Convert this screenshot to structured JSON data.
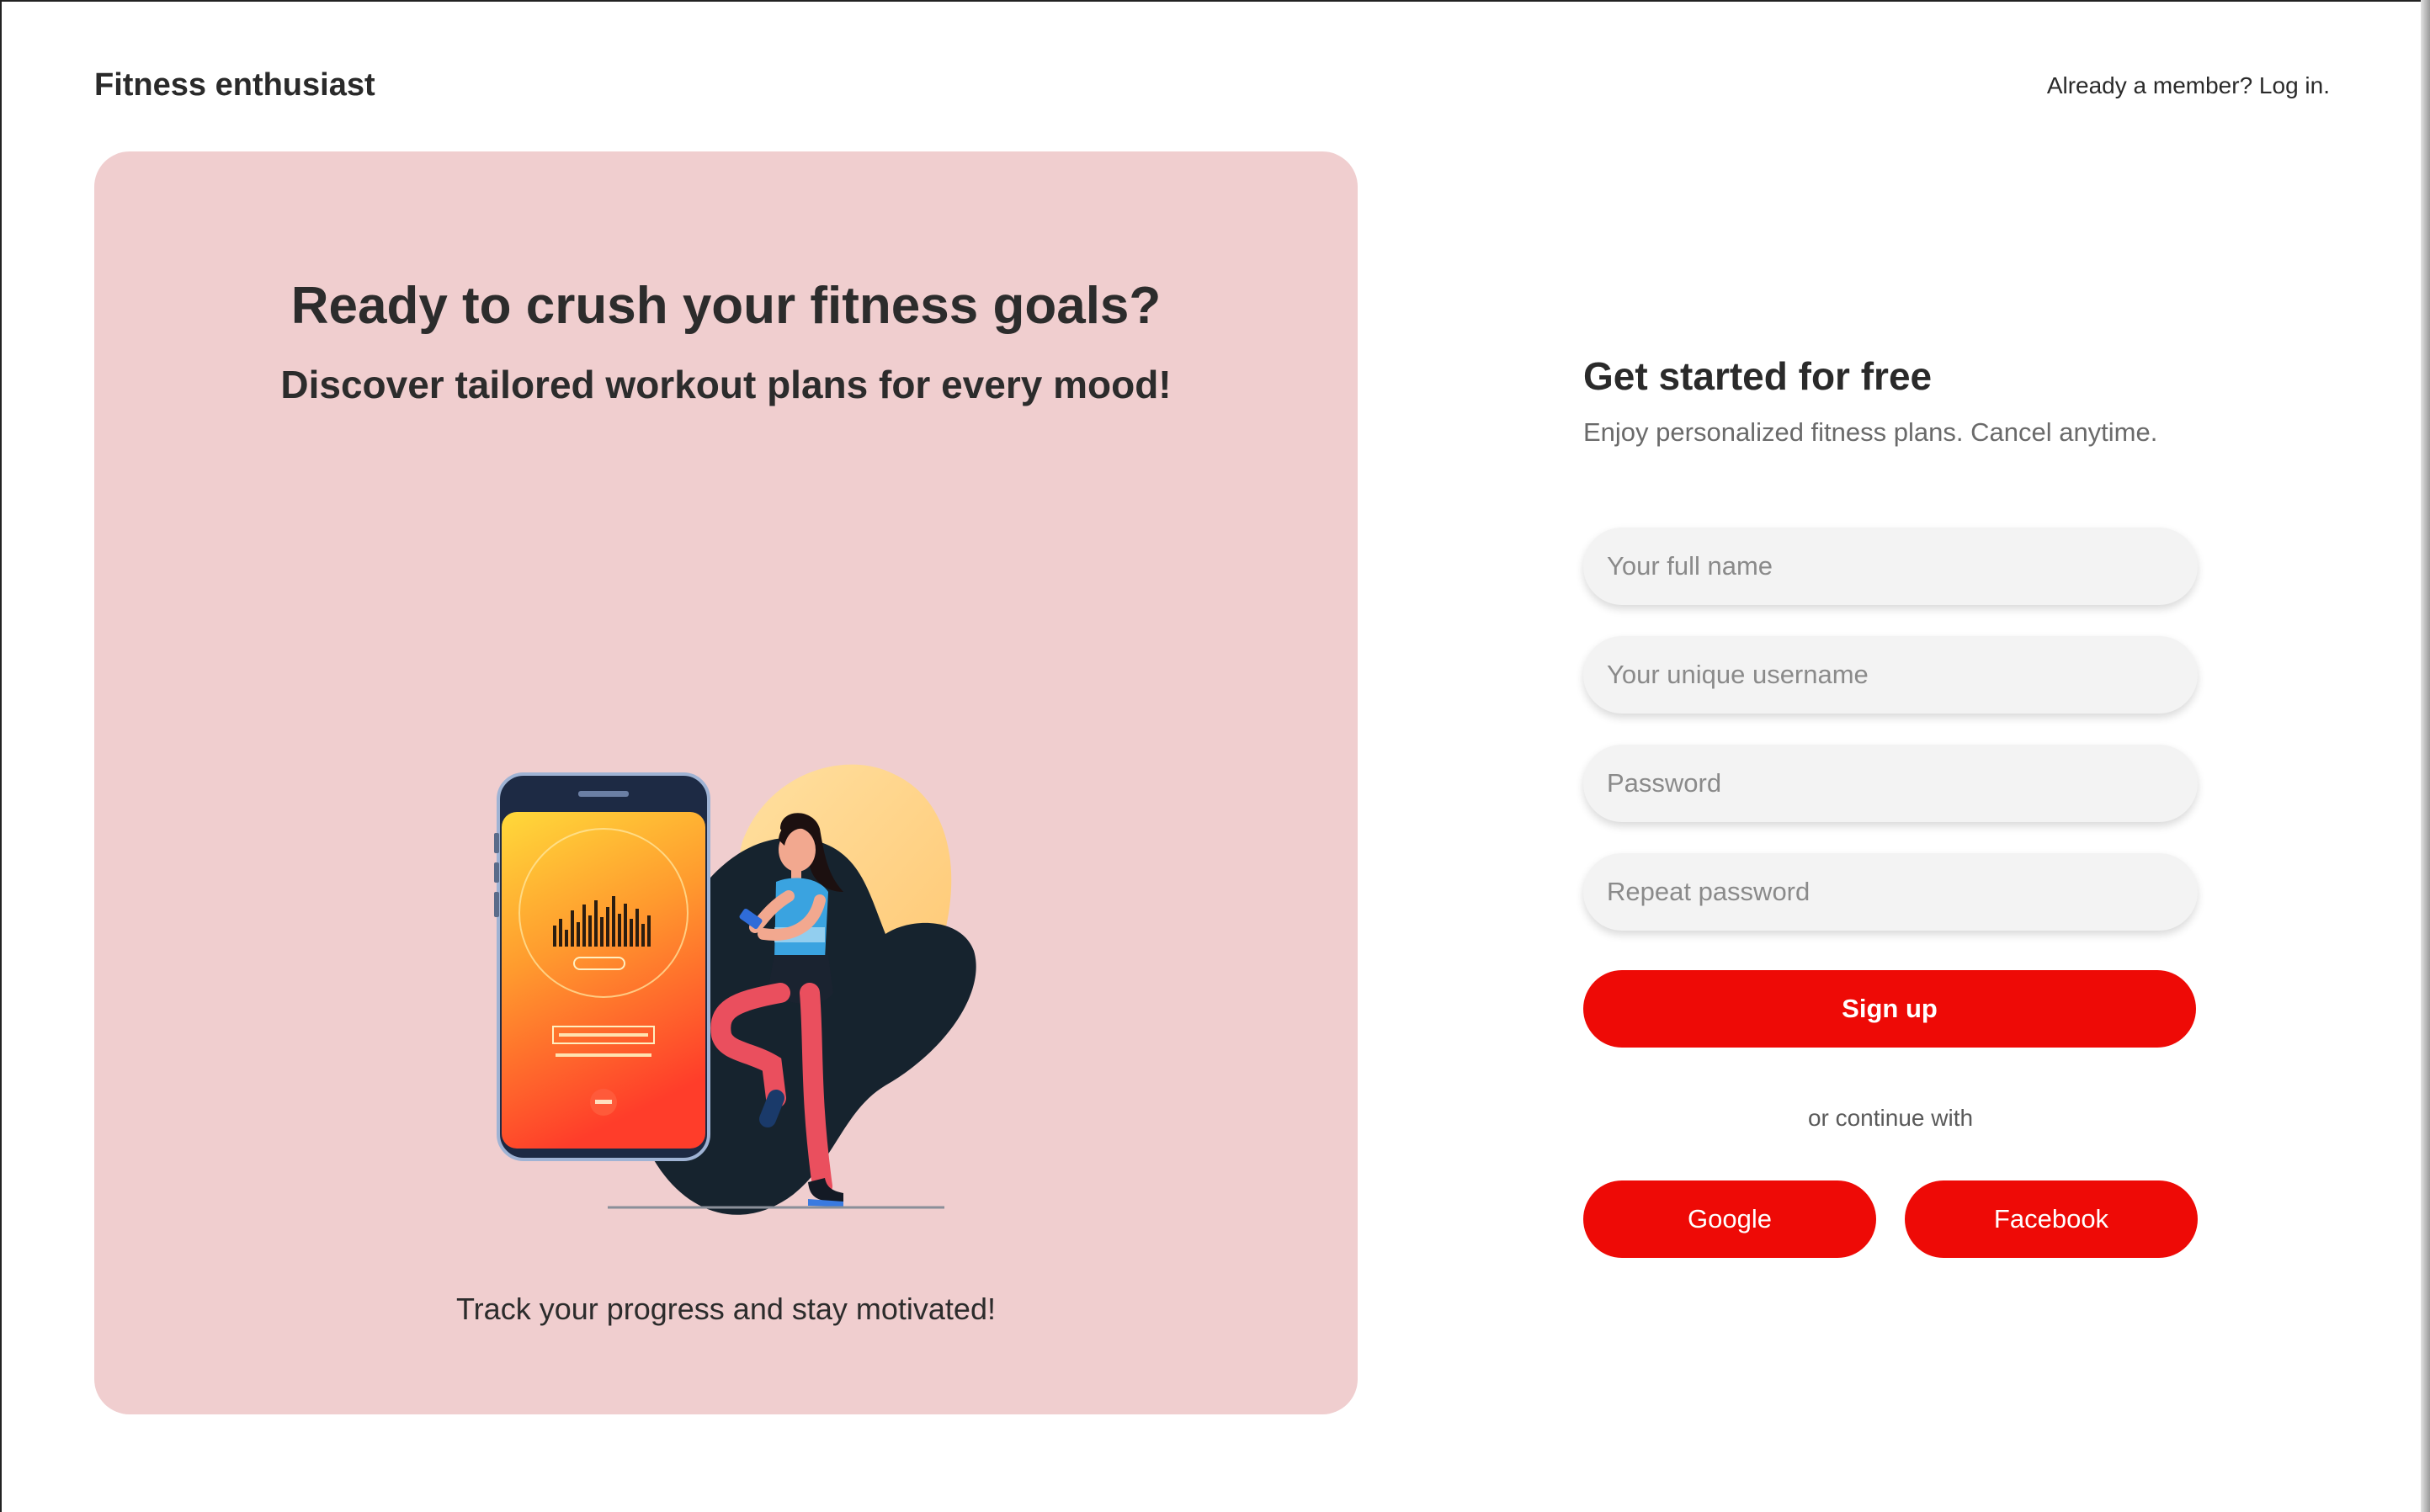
{
  "header": {
    "brand": "Fitness enthusiast",
    "login_link": "Already a member? Log in."
  },
  "hero": {
    "title": "Ready to crush your fitness goals?",
    "subtitle": "Discover tailored workout plans for every mood!",
    "caption": "Track your progress and stay motivated!",
    "background_color": "#f0cecf"
  },
  "form": {
    "title": "Get started for free",
    "subtitle": "Enjoy personalized fitness plans. Cancel anytime.",
    "fields": {
      "full_name": {
        "placeholder": "Your full name",
        "value": ""
      },
      "username": {
        "placeholder": "Your unique username",
        "value": ""
      },
      "password": {
        "placeholder": "Password",
        "value": ""
      },
      "repeat_password": {
        "placeholder": "Repeat password",
        "value": ""
      }
    },
    "signup_label": "Sign up",
    "divider_text": "or continue with",
    "social": {
      "google_label": "Google",
      "facebook_label": "Facebook"
    }
  },
  "colors": {
    "accent": "#ee0a06",
    "text": "#2b2b2b",
    "muted": "#6a6a6a",
    "field_bg": "#f3f3f3"
  },
  "icons": [
    "phone-illustration",
    "runner-illustration"
  ]
}
